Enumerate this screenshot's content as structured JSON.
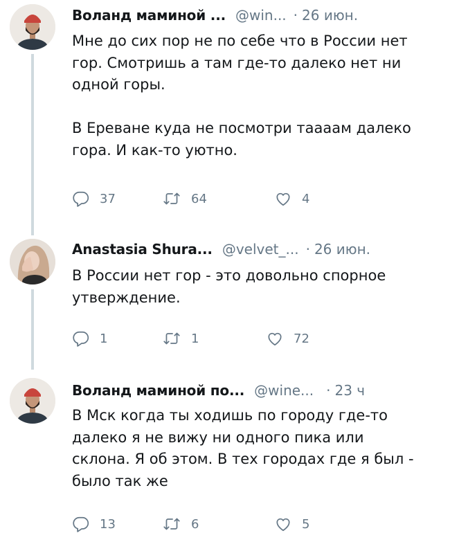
{
  "tweets": [
    {
      "name": "Воланд маминой ...",
      "handle": "@win...",
      "dot": "·",
      "time": "26 июн.",
      "text": "Мне до сих пор не по себе что в России нет\nгор. Смотришь а там где-то далеко нет ни\nодной горы.\n\nВ Ереване куда не посмотри таааам далеко\nгора. И как-то уютно.",
      "replies": "37",
      "retweets": "64",
      "likes": "4"
    },
    {
      "name": "Anastasia Shura...",
      "handle": "@velvet_...",
      "dot": "·",
      "time": "26 июн.",
      "text": "В России нет гор - это довольно спорное\nутверждение.",
      "replies": "1",
      "retweets": "1",
      "likes": "72"
    },
    {
      "name": "Воланд маминой по...",
      "handle": "@wine...",
      "dot": "·",
      "time": "23 ч",
      "text": "В Мск когда ты ходишь по городу где-то\nдалеко я не вижу ни одного пика или\nсклона. Я об этом. В тех городах где я был -\nбыло так же",
      "replies": "13",
      "retweets": "6",
      "likes": "5"
    }
  ],
  "colors": {
    "text": "#14171a",
    "meta": "#657786",
    "thread_line": "#cfd9de",
    "background": "#ffffff"
  },
  "icons": [
    "reply-icon",
    "retweet-icon",
    "like-icon"
  ]
}
